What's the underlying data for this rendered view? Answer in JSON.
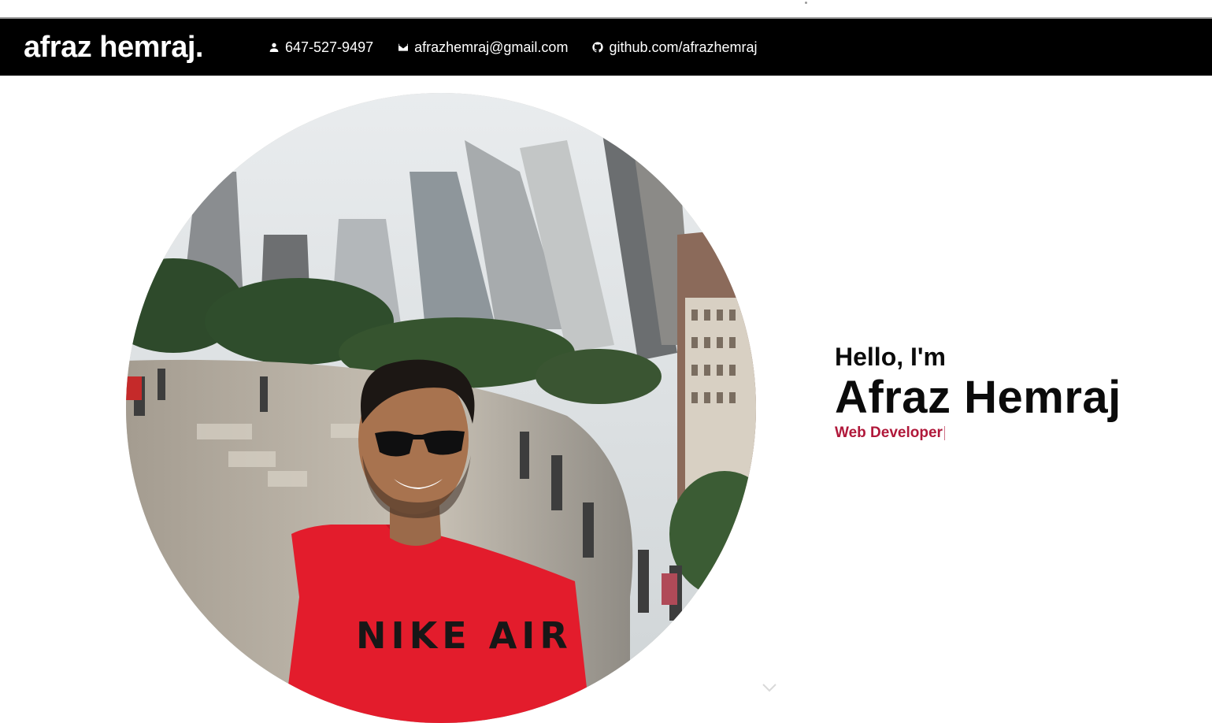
{
  "header": {
    "brand": "afraz hemraj.",
    "contacts": [
      {
        "icon": "person-icon",
        "label": "647-527-9497"
      },
      {
        "icon": "mail-icon",
        "label": "afrazhemraj@gmail.com"
      },
      {
        "icon": "github-icon",
        "label": "github.com/afrazhemraj"
      }
    ]
  },
  "hero": {
    "greeting": "Hello, I'm",
    "name": "Afraz Hemraj",
    "role": "Web Developer",
    "photo": {
      "shirt_text": "NIKE AIR"
    },
    "scroll_icon": "chevron-down-icon"
  },
  "colors": {
    "navbar_bg": "#000000",
    "accent": "#b0183a",
    "text": "#0b0b0b"
  }
}
